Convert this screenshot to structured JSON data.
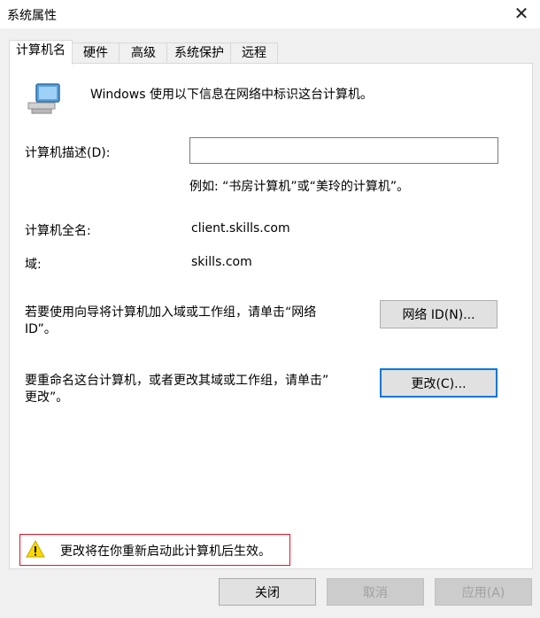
{
  "window": {
    "title": "系统属性"
  },
  "tabs": [
    {
      "label": "计算机名"
    },
    {
      "label": "硬件"
    },
    {
      "label": "高级"
    },
    {
      "label": "系统保护"
    },
    {
      "label": "远程"
    }
  ],
  "header": {
    "description": "Windows 使用以下信息在网络中标识这台计算机。"
  },
  "computer_description": {
    "label": "计算机描述(D):",
    "value": "",
    "example": "例如: “书房计算机”或“美玲的计算机”。"
  },
  "full_name": {
    "label": "计算机全名:",
    "value": "client.skills.com"
  },
  "domain": {
    "label": "域:",
    "value": "skills.com"
  },
  "network_id": {
    "text_line1": "若要使用向导将计算机加入域或工作组，请单击“网络",
    "text_line2": "ID”。",
    "button": "网络 ID(N)..."
  },
  "rename": {
    "text_line1": "要重命名这台计算机，或者更改其域或工作组，请单击”",
    "text_line2": "更改”。",
    "button": "更改(C)..."
  },
  "warning": {
    "text": "更改将在你重新启动此计算机后生效。"
  },
  "footer": {
    "close": "关闭",
    "cancel": "取消",
    "apply": "应用(A)"
  }
}
